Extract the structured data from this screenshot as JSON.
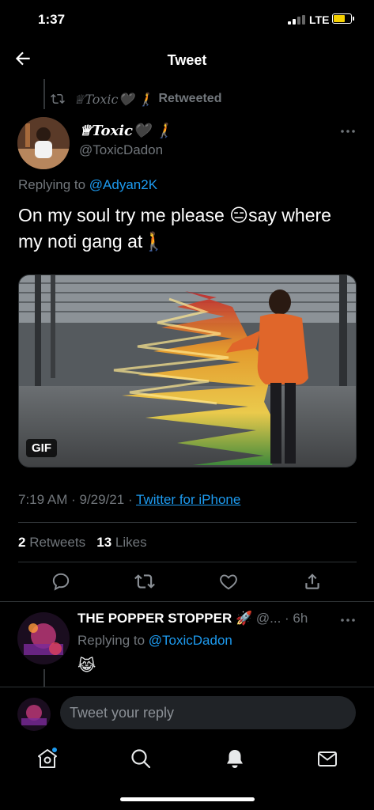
{
  "status_bar": {
    "time": "1:37",
    "network": "LTE"
  },
  "header": {
    "title": "Tweet"
  },
  "retweet_context": {
    "name": "♕Toxic🖤 🚶",
    "label": "Retweeted"
  },
  "tweet": {
    "display_name": "♕Toxic🖤 🚶",
    "handle": "@ToxicDadon",
    "replying_prefix": "Replying to ",
    "replying_handle": "@Adyan2K",
    "text": "On my soul try me please 😑say where my noti gang at🚶",
    "media_badge": "GIF",
    "time": "7:19 AM",
    "date": "9/29/21",
    "source": "Twitter for iPhone",
    "retweets_count": "2",
    "retweets_label": "Retweets",
    "likes_count": "13",
    "likes_label": "Likes"
  },
  "reply": {
    "display_name": "THE POPPER STOPPER 🚀",
    "handle": "@...",
    "time": "6h",
    "replying_prefix": "Replying to ",
    "replying_handle": "@ToxicDadon",
    "text": "😹"
  },
  "composer": {
    "placeholder": "Tweet your reply"
  },
  "tabs": [
    "home-icon",
    "search-icon",
    "notifications-icon",
    "messages-icon"
  ],
  "colors": {
    "accent": "#1d9bf0",
    "background": "#000000",
    "secondary_text": "#71767b",
    "battery": "#f5d000"
  }
}
